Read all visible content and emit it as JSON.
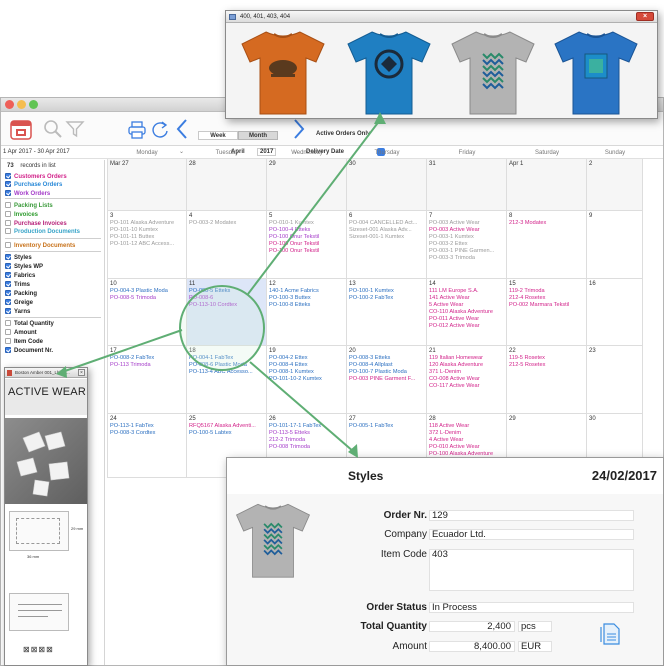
{
  "main_window": {
    "toolbar": {
      "week_label": "Week",
      "month_label": "Month",
      "active_orders_label": "Active Orders Only",
      "month_value": "April",
      "year_value": "2017",
      "date_field_value": "Delivery Date"
    },
    "date_range": "1 Apr 2017 - 30 Apr 2017",
    "sidebar": {
      "count": "73",
      "count_suffix": "records in list",
      "items": [
        {
          "label": "Customers Orders",
          "color": "#d2238a",
          "checked": true
        },
        {
          "label": "Purchase Orders",
          "color": "#2b8ad8",
          "checked": true
        },
        {
          "label": "Work Orders",
          "color": "#a43cc9",
          "checked": true
        },
        {
          "label": "Packing Lists",
          "color": "#3a9a3a",
          "checked": false
        },
        {
          "label": "Invoices",
          "color": "#2d9b2d",
          "checked": false
        },
        {
          "label": "Purchase Invoices",
          "color": "#b7237a",
          "checked": false
        },
        {
          "label": "Production Documents",
          "color": "#38a4c8",
          "checked": false
        },
        {
          "label": "Inventory Documents",
          "color": "#c8731c",
          "checked": false
        },
        {
          "label": "Styles",
          "color": "#222222",
          "checked": true
        },
        {
          "label": "Styles WP",
          "color": "#222222",
          "checked": true
        },
        {
          "label": "Fabrics",
          "color": "#222222",
          "checked": true
        },
        {
          "label": "Trims",
          "color": "#222222",
          "checked": true
        },
        {
          "label": "Packing",
          "color": "#222222",
          "checked": true
        },
        {
          "label": "Greige",
          "color": "#222222",
          "checked": true
        },
        {
          "label": "Yarns",
          "color": "#222222",
          "checked": true
        },
        {
          "label": "Total Quantity",
          "color": "#222222",
          "checked": false
        },
        {
          "label": "Amount",
          "color": "#222222",
          "checked": false
        },
        {
          "label": "Item Code",
          "color": "#222222",
          "checked": false
        },
        {
          "label": "Document Nr.",
          "color": "#222222",
          "checked": true
        }
      ]
    },
    "calendar": {
      "days": [
        "Monday",
        "Tuesday",
        "Wednesday",
        "Thursday",
        "Friday",
        "Saturday",
        "Sunday"
      ],
      "weeks": [
        [
          {
            "day": "Mar 27",
            "entries": []
          },
          {
            "day": "28",
            "entries": []
          },
          {
            "day": "29",
            "entries": []
          },
          {
            "day": "30",
            "entries": []
          },
          {
            "day": "31",
            "entries": []
          },
          {
            "day": "Apr 1",
            "entries": []
          },
          {
            "day": "2",
            "entries": []
          }
        ],
        [
          {
            "day": "3",
            "entries": [
              {
                "text": "PO-101 Alaska Adventure",
                "color": "#9a9a9a"
              },
              {
                "text": "PO-101-10 Kumtex",
                "color": "#9a9a9a"
              },
              {
                "text": "PO-101-11 Buttex",
                "color": "#9a9a9a"
              },
              {
                "text": "PO-101-12 ABC Access...",
                "color": "#9a9a9a"
              }
            ]
          },
          {
            "day": "4",
            "entries": [
              {
                "text": "PO-003-2 Modatex",
                "color": "#9a9a9a"
              }
            ]
          },
          {
            "day": "5",
            "entries": [
              {
                "text": "PO-010-1 Kumtex",
                "color": "#9a9a9a"
              },
              {
                "text": "PO-100-4 Etteks",
                "color": "#a43cc9"
              },
              {
                "text": "PO-100 Onur Tekstil",
                "color": "#a43cc9"
              },
              {
                "text": "PO-100 Onur Tekstil",
                "color": "#d2238a"
              },
              {
                "text": "PO-100 Onur Tekstil",
                "color": "#d2238a"
              }
            ]
          },
          {
            "day": "6",
            "entries": [
              {
                "text": "PO-004 CANCELLED Act...",
                "color": "#9a9a9a"
              },
              {
                "text": "Sizeset-001 Alaska Adv...",
                "color": "#9a9a9a"
              },
              {
                "text": "Sizeset-001-1 Kumtex",
                "color": "#9a9a9a"
              }
            ]
          },
          {
            "day": "7",
            "entries": [
              {
                "text": "PO-003 Active Wear",
                "color": "#9a9a9a"
              },
              {
                "text": "PO-003 Active Wear",
                "color": "#d2238a"
              },
              {
                "text": "PO-003-1 Kumtex",
                "color": "#9a9a9a"
              },
              {
                "text": "PO-003-2 Ettex",
                "color": "#9a9a9a"
              },
              {
                "text": "PO-003-1 PINE Garmen...",
                "color": "#9a9a9a"
              },
              {
                "text": "PO-003-3 Trimoda",
                "color": "#9a9a9a"
              }
            ]
          },
          {
            "day": "8",
            "entries": [
              {
                "text": "212-3 Modatex",
                "color": "#d2238a"
              }
            ]
          },
          {
            "day": "9",
            "entries": []
          }
        ],
        [
          {
            "day": "10",
            "entries": [
              {
                "text": "PO-004-3 Plastic Moda",
                "color": "#2b6fc0"
              },
              {
                "text": "PO-008-5 Trimoda",
                "color": "#a43cc9"
              }
            ]
          },
          {
            "day": "11",
            "entries": [
              {
                "text": "PO-008-5 Etteks",
                "color": "#2b6fc0"
              },
              {
                "text": "PO-008-6",
                "color": "#a43cc9"
              },
              {
                "text": "PO-113-10 Cordtex",
                "color": "#a43cc9"
              }
            ]
          },
          {
            "day": "12",
            "entries": [
              {
                "text": "140-1 Acme Fabrics",
                "color": "#2b6fc0"
              },
              {
                "text": "PO-100-3 Buttex",
                "color": "#2b6fc0"
              },
              {
                "text": "PO-100-8 Etteks",
                "color": "#2b6fc0"
              }
            ]
          },
          {
            "day": "13",
            "entries": [
              {
                "text": "PO-100-1 Kumtex",
                "color": "#2b6fc0"
              },
              {
                "text": "PO-100-2 FabTex",
                "color": "#2b6fc0"
              }
            ]
          },
          {
            "day": "14",
            "entries": [
              {
                "text": "111 LM Europe S.A.",
                "color": "#d2238a"
              },
              {
                "text": "141 Active Wear",
                "color": "#d2238a"
              },
              {
                "text": "5 Active Wear",
                "color": "#d2238a"
              },
              {
                "text": "CO-110 Alaska Adventure",
                "color": "#d2238a"
              },
              {
                "text": "PO-011 Active Wear",
                "color": "#d2238a"
              },
              {
                "text": "PO-012 Active Wear",
                "color": "#d2238a"
              }
            ]
          },
          {
            "day": "15",
            "entries": [
              {
                "text": "119-2 Trimoda",
                "color": "#d2238a"
              },
              {
                "text": "212-4 Rosetex",
                "color": "#d2238a"
              },
              {
                "text": "PO-002 Marmara Tekstil",
                "color": "#d2238a"
              }
            ]
          },
          {
            "day": "16",
            "entries": []
          }
        ],
        [
          {
            "day": "17",
            "entries": [
              {
                "text": "PO-008-2 FabTex",
                "color": "#2b6fc0"
              },
              {
                "text": "PO-113 Trimoda",
                "color": "#a43cc9"
              }
            ]
          },
          {
            "day": "18",
            "entries": [
              {
                "text": "PO-004-1 FabTex",
                "color": "#2b6fc0"
              },
              {
                "text": "PO-008-6 Plastic Moda",
                "color": "#2b6fc0"
              },
              {
                "text": "PO-113-4 ABC Accesso...",
                "color": "#2b6fc0"
              }
            ]
          },
          {
            "day": "19",
            "entries": [
              {
                "text": "PO-004-2 Ettex",
                "color": "#2b6fc0"
              },
              {
                "text": "PO-008-4 Ettex",
                "color": "#2b6fc0"
              },
              {
                "text": "PO-008-1 Kumtex",
                "color": "#2b6fc0"
              },
              {
                "text": "PO-101-10-2 Kumtex",
                "color": "#2b6fc0"
              }
            ]
          },
          {
            "day": "20",
            "entries": [
              {
                "text": "PO-008-3 Etteks",
                "color": "#2b6fc0"
              },
              {
                "text": "PO-008-4 Allplast",
                "color": "#2b6fc0"
              },
              {
                "text": "PO-100-7 Plastic Moda",
                "color": "#2b6fc0"
              },
              {
                "text": "PO-003 PINE Garment F...",
                "color": "#d2238a"
              }
            ]
          },
          {
            "day": "21",
            "entries": [
              {
                "text": "119 Italian Homewear",
                "color": "#d2238a"
              },
              {
                "text": "120 Alaska Adventure",
                "color": "#d2238a"
              },
              {
                "text": "371 L-Denim",
                "color": "#d2238a"
              },
              {
                "text": "CO-008 Active Wear",
                "color": "#d2238a"
              },
              {
                "text": "CO-117 Active Wear",
                "color": "#d2238a"
              }
            ]
          },
          {
            "day": "22",
            "entries": [
              {
                "text": "119-5 Rosetex",
                "color": "#d2238a"
              },
              {
                "text": "212-5 Rosetex",
                "color": "#d2238a"
              }
            ]
          },
          {
            "day": "23",
            "entries": []
          }
        ],
        [
          {
            "day": "24",
            "entries": [
              {
                "text": "PO-113-1 FabTex",
                "color": "#2b6fc0"
              },
              {
                "text": "PO-008-3 Cordtex",
                "color": "#2b6fc0"
              }
            ]
          },
          {
            "day": "25",
            "entries": [
              {
                "text": "RFQ5167 Alaska Adventi...",
                "color": "#d2238a"
              },
              {
                "text": "PO-100-5 Labtex",
                "color": "#2b6fc0"
              }
            ]
          },
          {
            "day": "26",
            "entries": [
              {
                "text": "PO-101-17-1 FabTex",
                "color": "#2b6fc0"
              },
              {
                "text": "PO-113-5 Etteks",
                "color": "#a43cc9"
              },
              {
                "text": "212-2 Trimoda",
                "color": "#a43cc9"
              },
              {
                "text": "PO-008 Trimoda",
                "color": "#a43cc9"
              }
            ]
          },
          {
            "day": "27",
            "entries": [
              {
                "text": "PO-005-1 FabTex",
                "color": "#2b6fc0"
              }
            ]
          },
          {
            "day": "28",
            "entries": [
              {
                "text": "118 Active Wear",
                "color": "#d2238a"
              },
              {
                "text": "372 L-Denim",
                "color": "#d2238a"
              },
              {
                "text": "4 Active Wear",
                "color": "#d2238a"
              },
              {
                "text": "PO-010 Active Wear",
                "color": "#d2238a"
              },
              {
                "text": "PO-100 Alaska Adventure",
                "color": "#d2238a"
              }
            ]
          },
          {
            "day": "29",
            "entries": []
          },
          {
            "day": "30",
            "entries": []
          }
        ]
      ]
    }
  },
  "shirts_window": {
    "title": "400, 401, 403, 404"
  },
  "label_window": {
    "title": "Boston Amber 001_Lbl.Pr...",
    "heading": "ACTIVE WEAR",
    "dimension_a": "29 mm",
    "dimension_b": "36 mm"
  },
  "styles_window": {
    "title": "Styles",
    "date": "24/02/2017",
    "order_nr_label": "Order Nr.",
    "order_nr": "129",
    "company_label": "Company",
    "company": "Ecuador Ltd.",
    "item_code_label": "Item Code",
    "item_code": "403",
    "order_status_label": "Order Status",
    "order_status": "In Process",
    "total_quantity_label": "Total Quantity",
    "total_quantity": "2,400",
    "quantity_unit": "pcs",
    "amount_label": "Amount",
    "amount": "8,400.00",
    "currency": "EUR"
  },
  "colors": {
    "accent_red": "#d9534f",
    "link_blue": "#2b6fc0",
    "connector_green": "#5fae74"
  }
}
